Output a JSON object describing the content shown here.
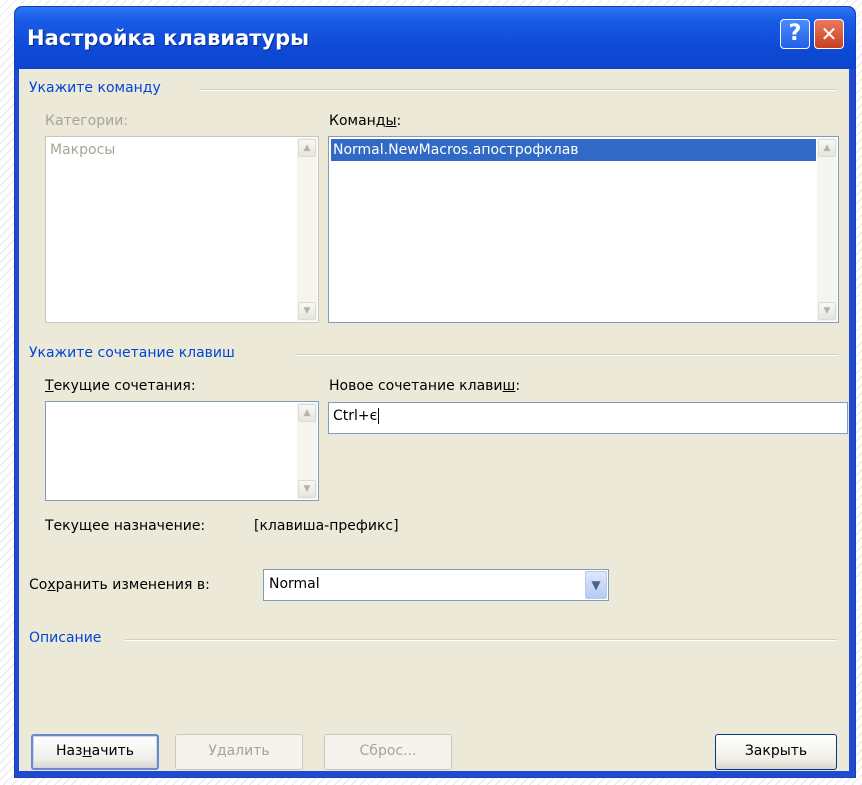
{
  "window": {
    "title": "Настройка клавиатуры",
    "help_button": "?",
    "close_button": "✕"
  },
  "specify_command": {
    "group_label": "Укажите команду",
    "categories": {
      "label": "Категории:",
      "items": [
        "Макросы"
      ],
      "enabled": false
    },
    "commands": {
      "label_prefix": "Команд",
      "label_accel": "ы",
      "label_suffix": ":",
      "items": [
        "Normal.NewMacros.апострофклав"
      ],
      "selected_index": 0
    }
  },
  "specify_shortcut": {
    "group_label": "Укажите сочетание клавиш",
    "current_keys": {
      "label_accel": "Т",
      "label_rest": "екущие сочетания:",
      "items": []
    },
    "new_shortcut": {
      "label_prefix": "Новое сочетание клави",
      "label_accel": "ш",
      "label_suffix": ":",
      "value": "Ctrl+є"
    },
    "current_assignment": {
      "label": "Текущее назначение:",
      "value": "[клавиша-префикс]"
    }
  },
  "save_changes": {
    "label_prefix": "Со",
    "label_accel": "х",
    "label_suffix": "ранить изменения в:",
    "value": "Normal"
  },
  "description": {
    "group_label": "Описание"
  },
  "buttons": {
    "assign": {
      "prefix": "Наз",
      "accel": "н",
      "suffix": "ачить"
    },
    "remove": "Удалить",
    "reset": "Сброс...",
    "close": "Закрыть"
  },
  "colors": {
    "titlebar": "#0b45cf",
    "group_label": "#0046d5",
    "selection": "#316ac5",
    "dialog_bg": "#ece9d8"
  },
  "icons": {
    "scroll_up": "▲",
    "scroll_down": "▼",
    "dropdown": "▼"
  }
}
